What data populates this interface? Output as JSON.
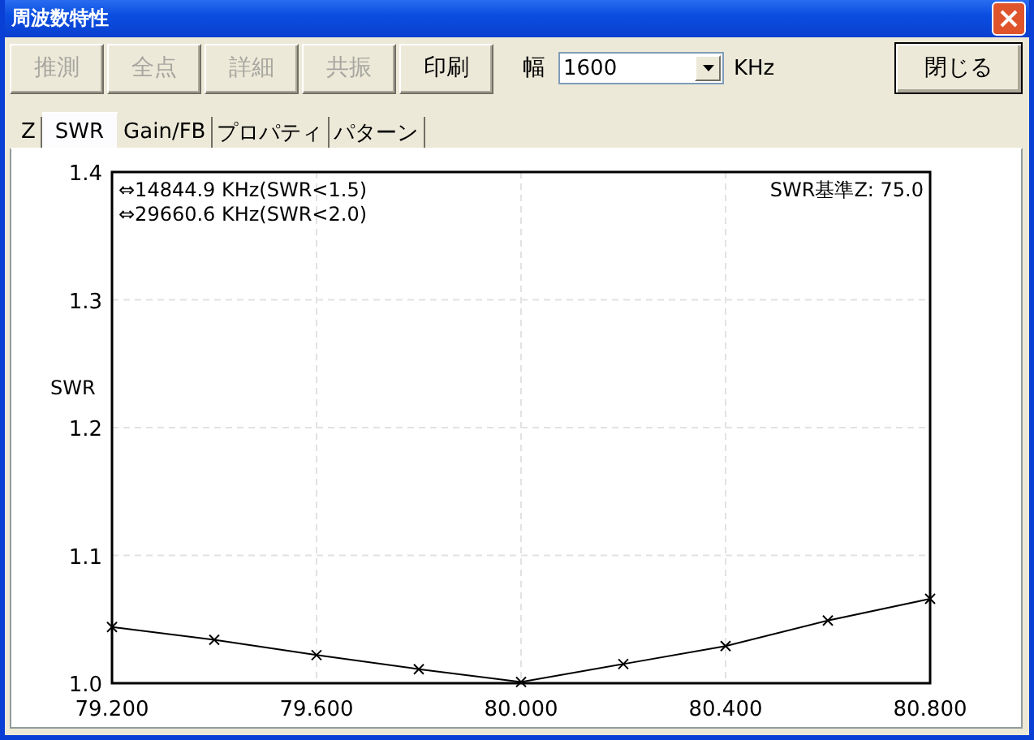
{
  "window": {
    "title": "周波数特性"
  },
  "toolbar": {
    "buttons": [
      {
        "label": "推測",
        "disabled": true
      },
      {
        "label": "全点",
        "disabled": true
      },
      {
        "label": "詳細",
        "disabled": true
      },
      {
        "label": "共振",
        "disabled": true
      },
      {
        "label": "印刷",
        "disabled": false
      }
    ],
    "width_label": "幅",
    "width_value": "1600",
    "width_unit": "KHz",
    "close_button": "閉じる"
  },
  "tabs": [
    {
      "label": "Z",
      "selected": false
    },
    {
      "label": "SWR",
      "selected": true
    },
    {
      "label": "Gain/FB",
      "selected": false
    },
    {
      "label": "プロパティ",
      "selected": false
    },
    {
      "label": "パターン",
      "selected": false
    }
  ],
  "chart": {
    "bandwidth_lines": [
      "⇔14844.9 KHz(SWR<1.5)",
      "⇔29660.6 KHz(SWR<2.0)"
    ],
    "reference": "SWR基準Z: 75.0",
    "chart_data": {
      "type": "line",
      "ylabel": "SWR",
      "x": [
        79.2,
        79.4,
        79.6,
        79.8,
        80.0,
        80.2,
        80.4,
        80.6,
        80.8
      ],
      "grid": true,
      "series": [
        {
          "color": "#000000",
          "marker": "x",
          "values": [
            1.044,
            1.034,
            1.022,
            1.011,
            1.001,
            1.015,
            1.029,
            1.049,
            1.066
          ]
        }
      ],
      "xlim": [
        79.2,
        80.8
      ],
      "ylim": [
        1.0,
        1.4
      ],
      "xticks": [
        {
          "value": 79.2,
          "label": "79.200"
        },
        {
          "value": 79.6,
          "label": "79.600"
        },
        {
          "value": 80.0,
          "label": "80.000"
        },
        {
          "value": 80.4,
          "label": "80.400"
        },
        {
          "value": 80.8,
          "label": "80.800"
        }
      ],
      "yticks": [
        {
          "value": 1.0,
          "label": "1.0"
        },
        {
          "value": 1.1,
          "label": "1.1"
        },
        {
          "value": 1.2,
          "label": "1.2"
        },
        {
          "value": 1.3,
          "label": "1.3"
        },
        {
          "value": 1.4,
          "label": "1.4"
        }
      ]
    }
  }
}
